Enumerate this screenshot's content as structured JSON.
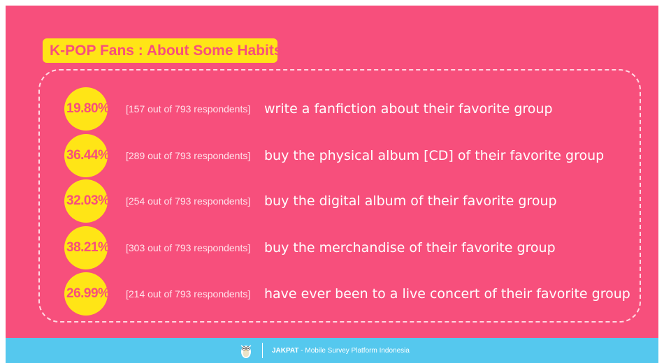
{
  "title": "K-POP Fans : About Some Habits",
  "habits": [
    {
      "percent": "19.80%",
      "respondents": "[157 out of 793 respondents]",
      "text": "write a fanfiction about their favorite group"
    },
    {
      "percent": "36.44%",
      "respondents": "[289 out of 793 respondents]",
      "text": "buy the physical album [CD] of their favorite group"
    },
    {
      "percent": "32.03%",
      "respondents": "[254 out of 793 respondents]",
      "text": "buy the digital album of their favorite group"
    },
    {
      "percent": "38.21%",
      "respondents": "[303 out of 793 respondents]",
      "text": "buy the merchandise of their favorite group"
    },
    {
      "percent": "26.99%",
      "respondents": "[214 out of 793 respondents]",
      "text": "have ever been to a live concert of their favorite group"
    }
  ],
  "footer": {
    "brand": "JAKPAT",
    "tagline": " - Mobile Survey Platform Indonesia",
    "icon": "owl-mascot-icon"
  },
  "colors": {
    "background": "#f74f7c",
    "accent": "#ffe516",
    "footer": "#55c8ee"
  }
}
